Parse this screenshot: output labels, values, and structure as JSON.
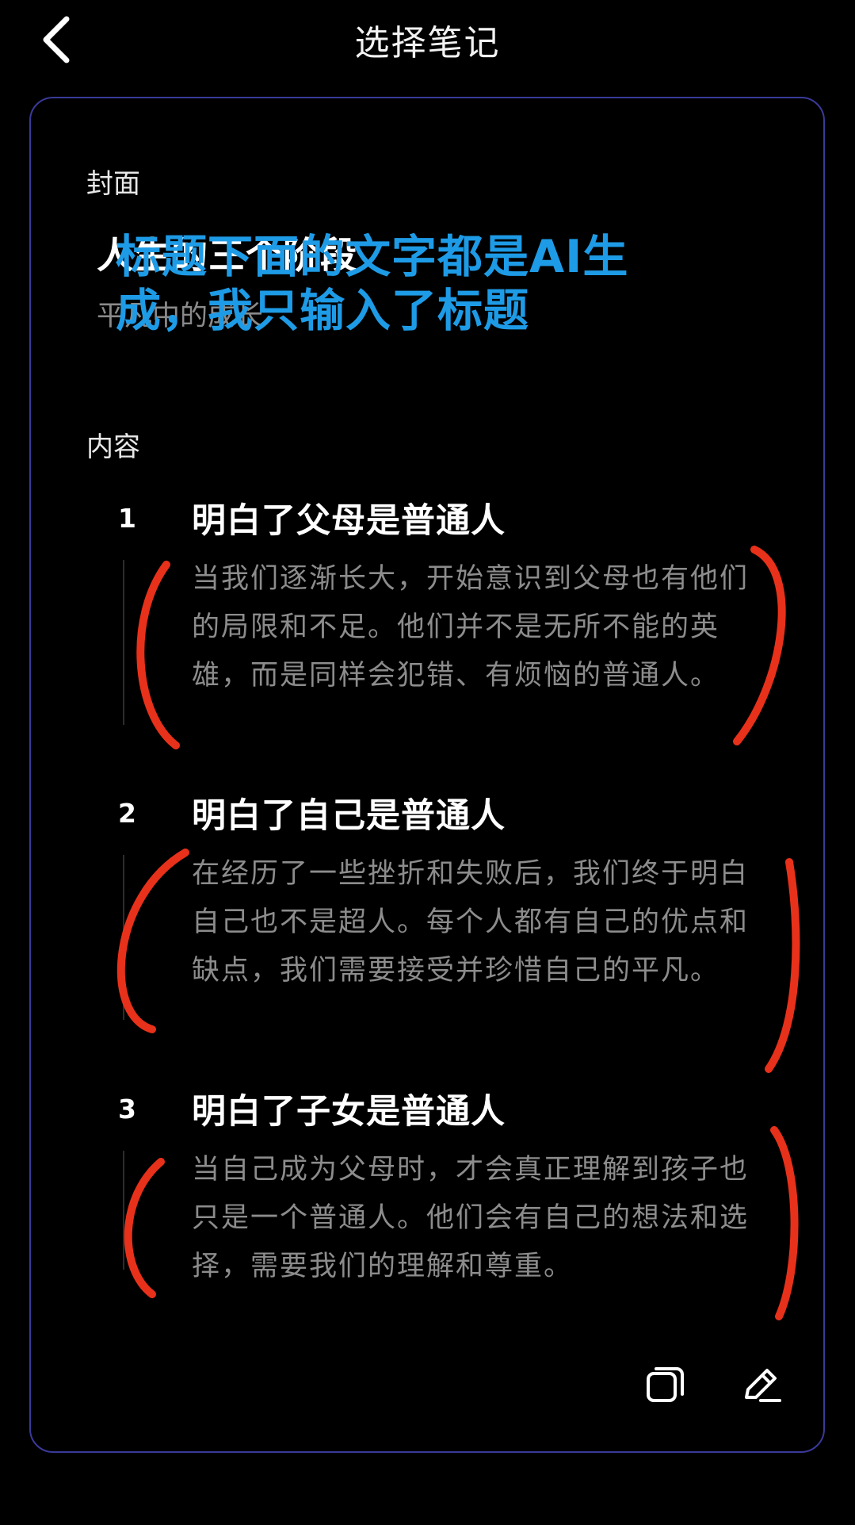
{
  "header": {
    "title": "选择笔记",
    "back_icon": "chevron-left-icon"
  },
  "cover": {
    "label": "封面",
    "title": "人生的三个阶段",
    "subtitle": "平凡中的成长"
  },
  "annotation": {
    "text": "标题下面的文字都是AI生成，我只输入了标题",
    "color": "#1e9be6"
  },
  "content": {
    "label": "内容",
    "items": [
      {
        "number": "1",
        "title": "明白了父母是普通人",
        "body": "当我们逐渐长大，开始意识到父母也有他们的局限和不足。他们并不是无所不能的英雄，而是同样会犯错、有烦恼的普通人。"
      },
      {
        "number": "2",
        "title": "明白了自己是普通人",
        "body": "在经历了一些挫折和失败后，我们终于明白自己也不是超人。每个人都有自己的优点和缺点，我们需要接受并珍惜自己的平凡。"
      },
      {
        "number": "3",
        "title": "明白了子女是普通人",
        "body": "当自己成为父母时，才会真正理解到孩子也只是一个普通人。他们会有自己的想法和选择，需要我们的理解和尊重。"
      }
    ]
  },
  "actions": {
    "copy_icon": "copy-icon",
    "edit_icon": "edit-pencil-icon"
  },
  "colors": {
    "background": "#000000",
    "card_border": "#3a3a9a",
    "body_text": "#8c8c8c",
    "annotation_marks": "#e8311a"
  }
}
